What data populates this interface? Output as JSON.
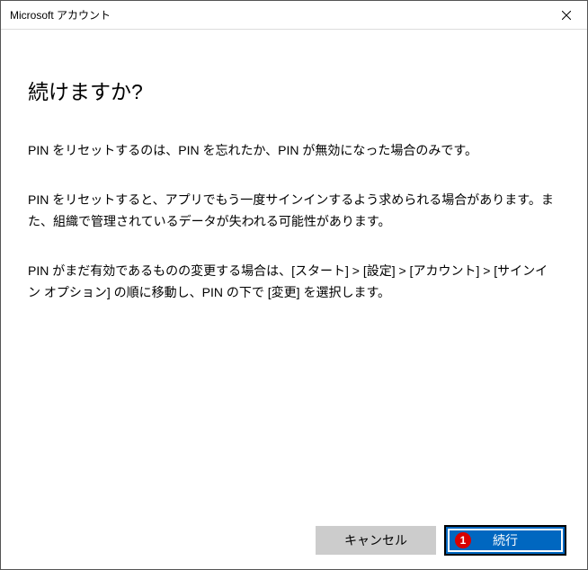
{
  "titlebar": {
    "title": "Microsoft アカウント"
  },
  "content": {
    "heading": "続けますか?",
    "para1": "PIN をリセットするのは、PIN を忘れたか、PIN が無効になった場合のみです。",
    "para2": "PIN をリセットすると、アプリでもう一度サインインするよう求められる場合があります。また、組織で管理されているデータが失われる可能性があります。",
    "para3": "PIN がまだ有効であるものの変更する場合は、[スタート] > [設定] > [アカウント] > [サインイン オプション] の順に移動し、PIN の下で [変更] を選択します。"
  },
  "footer": {
    "cancel": "キャンセル",
    "continue": "続行",
    "badge": "1"
  }
}
